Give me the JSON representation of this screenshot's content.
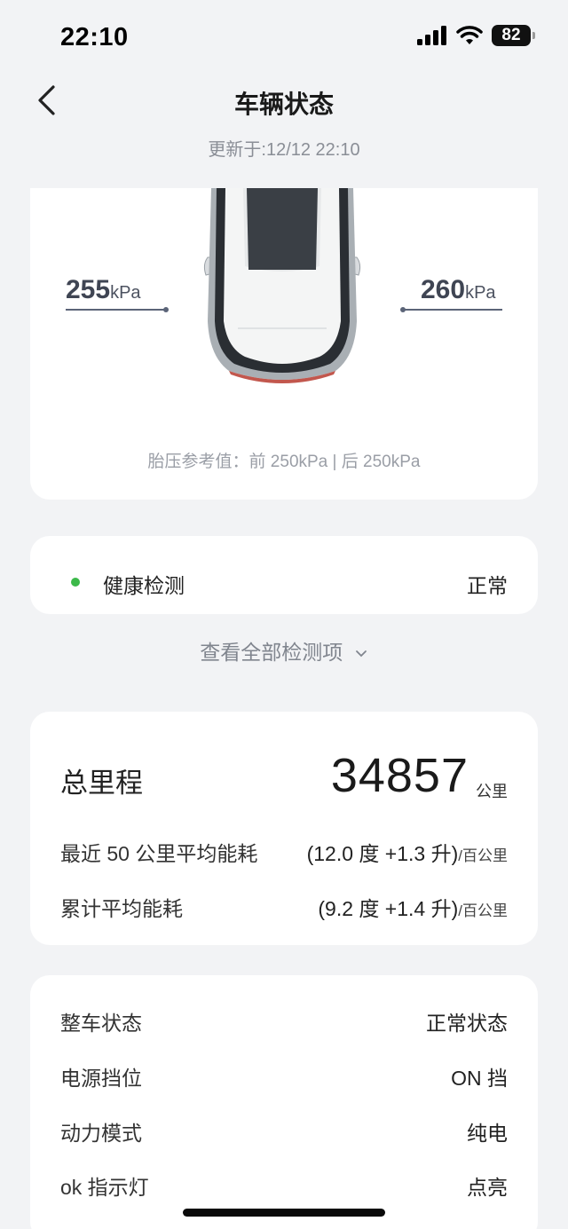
{
  "status_bar": {
    "time": "22:10",
    "battery": "82",
    "icons": [
      "signal-icon",
      "wifi-icon",
      "battery-icon"
    ]
  },
  "header": {
    "title": "车辆状态",
    "updated": "更新于:12/12 22:10",
    "back_icon": "chevron-left-icon"
  },
  "tires": {
    "front_left_value": "255",
    "front_right_value": "260",
    "unit": "kPa",
    "reference": "胎压参考值：前 250kPa | 后 250kPa"
  },
  "health": {
    "label": "健康检测",
    "value": "正常",
    "status_color": "#3cb94a",
    "view_all": "查看全部检测项"
  },
  "mileage": {
    "total_label": "总里程",
    "total_value": "34857",
    "total_unit": "公里",
    "recent_label": "最近 50 公里平均能耗",
    "recent_value": "(12.0 度 +1.3 升)",
    "recent_unit": "/百公里",
    "cumulative_label": "累计平均能耗",
    "cumulative_value": "(9.2 度 +1.4 升)",
    "cumulative_unit": "/百公里"
  },
  "vehicle_status": [
    {
      "label": "整车状态",
      "value": "正常状态"
    },
    {
      "label": "电源挡位",
      "value": "ON 挡"
    },
    {
      "label": "动力模式",
      "value": "纯电"
    },
    {
      "label": "ok 指示灯",
      "value": "点亮"
    }
  ]
}
